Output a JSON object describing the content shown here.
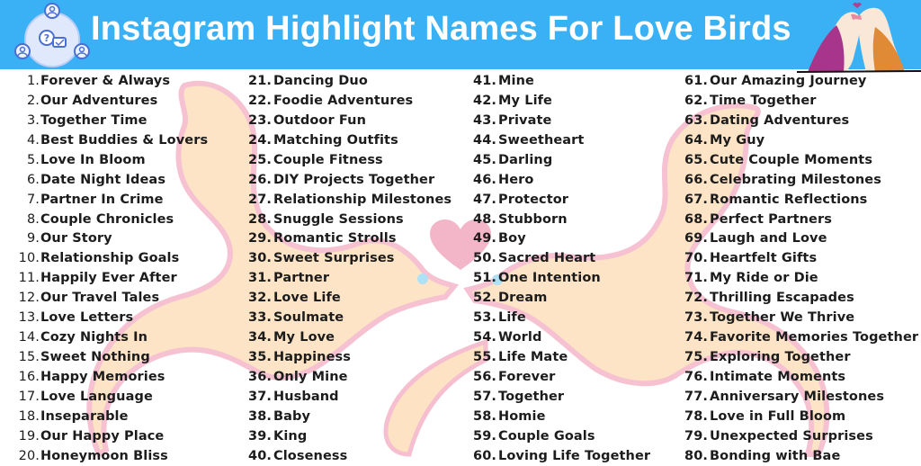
{
  "header": {
    "title": "Instagram Highlight Names For Love Birds",
    "background_color": "#3bb1f5",
    "logo_icon": "social-network-chat-icon",
    "decoration": "love-birds-illustration"
  },
  "background": {
    "decoration": "two-doves-with-heart",
    "dove_color": "#fde3c4",
    "dove_outline_color": "#f6bfd0",
    "heart_color": "#f3b6c8"
  },
  "columns": [
    {
      "items": [
        {
          "num": "1.",
          "label": "Forever & Always"
        },
        {
          "num": "2.",
          "label": "Our Adventures"
        },
        {
          "num": "3.",
          "label": "Together Time"
        },
        {
          "num": "4.",
          "label": "Best Buddies & Lovers"
        },
        {
          "num": "5.",
          "label": "Love In Bloom"
        },
        {
          "num": "6.",
          "label": "Date Night Ideas"
        },
        {
          "num": "7.",
          "label": "Partner In Crime"
        },
        {
          "num": "8.",
          "label": "Couple Chronicles"
        },
        {
          "num": "9.",
          "label": "Our Story"
        },
        {
          "num": "10.",
          "label": "Relationship Goals"
        },
        {
          "num": "11.",
          "label": "Happily Ever After"
        },
        {
          "num": "12.",
          "label": "Our Travel Tales"
        },
        {
          "num": "13.",
          "label": "Love Letters"
        },
        {
          "num": "14.",
          "label": "Cozy Nights In"
        },
        {
          "num": "15.",
          "label": "Sweet Nothing"
        },
        {
          "num": "16.",
          "label": "Happy Memories"
        },
        {
          "num": "17.",
          "label": "Love Language"
        },
        {
          "num": "18.",
          "label": "Inseparable"
        },
        {
          "num": "19.",
          "label": "Our Happy Place"
        },
        {
          "num": "20.",
          "label": "Honeymoon Bliss"
        }
      ]
    },
    {
      "items": [
        {
          "num": "21.",
          "label": "Dancing Duo"
        },
        {
          "num": "22.",
          "label": "Foodie Adventures"
        },
        {
          "num": "23.",
          "label": "Outdoor Fun"
        },
        {
          "num": "24.",
          "label": "Matching Outfits"
        },
        {
          "num": "25.",
          "label": "Couple Fitness"
        },
        {
          "num": "26.",
          "label": "DIY Projects Together"
        },
        {
          "num": "27.",
          "label": "Relationship Milestones"
        },
        {
          "num": "28.",
          "label": "Snuggle Sessions"
        },
        {
          "num": "29.",
          "label": "Romantic Strolls"
        },
        {
          "num": "30.",
          "label": "Sweet Surprises"
        },
        {
          "num": "31.",
          "label": "Partner"
        },
        {
          "num": "32.",
          "label": "Love Life"
        },
        {
          "num": "33.",
          "label": "Soulmate"
        },
        {
          "num": "34.",
          "label": "My Love"
        },
        {
          "num": "35.",
          "label": "Happiness"
        },
        {
          "num": "36.",
          "label": "Only Mine"
        },
        {
          "num": "37.",
          "label": "Husband"
        },
        {
          "num": "38.",
          "label": "Baby"
        },
        {
          "num": "39.",
          "label": "King"
        },
        {
          "num": "40.",
          "label": "Closeness"
        }
      ]
    },
    {
      "items": [
        {
          "num": "41.",
          "label": "Mine"
        },
        {
          "num": "42.",
          "label": "My Life"
        },
        {
          "num": "43.",
          "label": "Private"
        },
        {
          "num": "44.",
          "label": "Sweetheart"
        },
        {
          "num": "45.",
          "label": "Darling"
        },
        {
          "num": "46.",
          "label": "Hero"
        },
        {
          "num": "47.",
          "label": "Protector"
        },
        {
          "num": "48.",
          "label": "Stubborn"
        },
        {
          "num": "49.",
          "label": "Boy"
        },
        {
          "num": "50.",
          "label": "Sacred Heart"
        },
        {
          "num": "51.",
          "label": "One Intention"
        },
        {
          "num": "52.",
          "label": "Dream"
        },
        {
          "num": "53.",
          "label": "Life"
        },
        {
          "num": "54.",
          "label": "World"
        },
        {
          "num": "55.",
          "label": "Life Mate"
        },
        {
          "num": "56.",
          "label": "Forever"
        },
        {
          "num": "57.",
          "label": "Together"
        },
        {
          "num": "58.",
          "label": "Homie"
        },
        {
          "num": "59.",
          "label": "Couple Goals"
        },
        {
          "num": "60.",
          "label": "Loving Life Together"
        }
      ]
    },
    {
      "items": [
        {
          "num": "61.",
          "label": "Our Amazing Journey"
        },
        {
          "num": "62.",
          "label": "Time Together"
        },
        {
          "num": "63.",
          "label": "Dating Adventures"
        },
        {
          "num": "64.",
          "label": "My Guy"
        },
        {
          "num": "65.",
          "label": "Cute Couple Moments"
        },
        {
          "num": "66.",
          "label": "Celebrating Milestones"
        },
        {
          "num": "67.",
          "label": "Romantic Reflections"
        },
        {
          "num": "68.",
          "label": "Perfect Partners"
        },
        {
          "num": "69.",
          "label": "Laugh and Love"
        },
        {
          "num": "70.",
          "label": "Heartfelt Gifts"
        },
        {
          "num": "71.",
          "label": "My Ride or Die"
        },
        {
          "num": "72.",
          "label": "Thrilling Escapades"
        },
        {
          "num": "73.",
          "label": "Together We Thrive"
        },
        {
          "num": "74.",
          "label": "Favorite Memories Together"
        },
        {
          "num": "75.",
          "label": "Exploring Together"
        },
        {
          "num": "76.",
          "label": "Intimate Moments"
        },
        {
          "num": "77.",
          "label": "Anniversary Milestones"
        },
        {
          "num": "78.",
          "label": "Love in Full Bloom"
        },
        {
          "num": "79.",
          "label": "Unexpected Surprises"
        },
        {
          "num": "80.",
          "label": "Bonding with Bae"
        }
      ]
    }
  ]
}
